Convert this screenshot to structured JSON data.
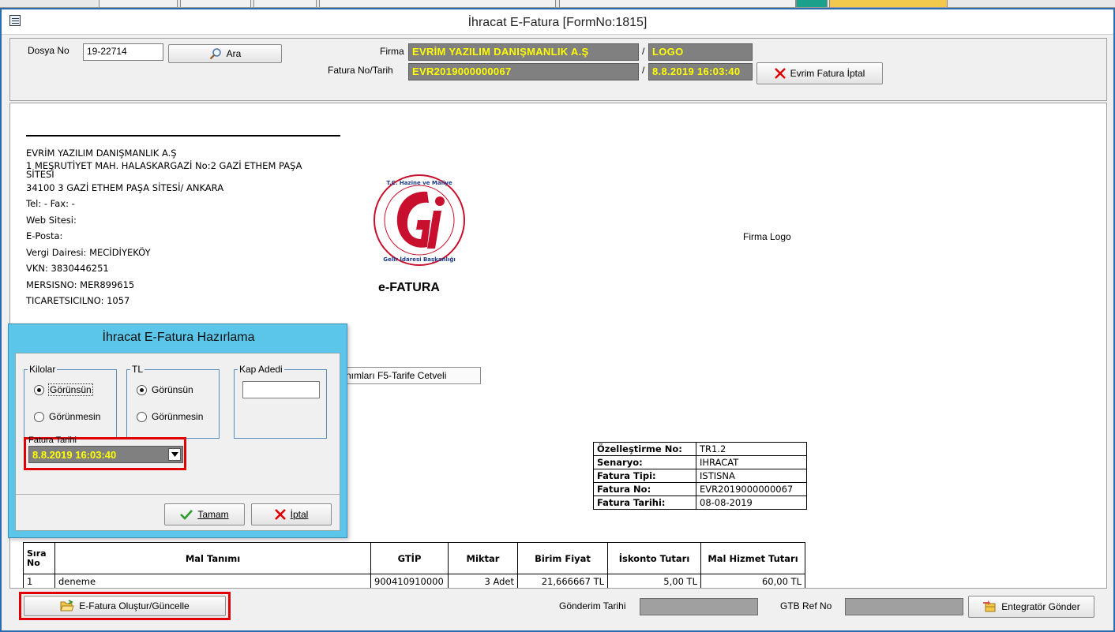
{
  "window": {
    "title": "İhracat E-Fatura [FormNo:1815]"
  },
  "search": {
    "dosya_no_label": "Dosya No",
    "dosya_no_value": "19-22714",
    "ara_button": "Ara",
    "firma_label": "Firma",
    "firma_value": "EVRİM YAZILIM DANIŞMANLIK A.Ş",
    "firma_code_sep": "/",
    "firma_code_value": "LOGO",
    "fatura_label": "Fatura No/Tarih",
    "fatura_no_value": "EVR2019000000067",
    "fatura_tarih_sep": "/",
    "fatura_tarih_value": "8.8.2019 16:03:40",
    "iptal_button": "Evrim Fatura İptal"
  },
  "invoice": {
    "company_lines": [
      "EVRİM YAZILIM DANIŞMANLIK A.Ş",
      "1 MEŞRUTİYET MAH. HALASKARGAZİ  No:2 GAZİ ETHEM PAŞA SİTESİ",
      "34100 3 GAZİ ETHEM PAŞA SİTESİ/ ANKARA",
      "Tel: - Fax: -",
      "Web Sitesi:",
      "E-Posta:",
      "Vergi Dairesi: MECİDİYEKÖY",
      "VKN: 3830446251",
      "MERSISNO: MER899615",
      "TICARETSICILNO: 1057"
    ],
    "gib_logo_text": "T.C. Hazine ve Maliye Bakanlığı · Gelir İdaresi Başkanlığı",
    "efatura_label": "e-FATURA",
    "firma_logo_label": "Firma Logo",
    "partial_button": "nımları F5-Tarife Cetveli",
    "info_rows": [
      {
        "key": "Özelleştirme No:",
        "value": "TR1.2"
      },
      {
        "key": "Senaryo:",
        "value": "IHRACAT"
      },
      {
        "key": "Fatura Tipi:",
        "value": "ISTISNA"
      },
      {
        "key": "Fatura No:",
        "value": "EVR2019000000067"
      },
      {
        "key": "Fatura Tarihi:",
        "value": "08-08-2019"
      }
    ],
    "items_headers": [
      "Sıra No",
      "Mal Tanımı",
      "GTİP",
      "Miktar",
      "Birim Fiyat",
      "İskonto Tutarı",
      "Mal Hizmet Tutarı"
    ],
    "items_rows": [
      [
        "1",
        "deneme",
        "900410910000",
        "3 Adet",
        "21,666667 TL",
        "5,00 TL",
        "60,00 TL"
      ]
    ]
  },
  "bottom": {
    "olustur_button": "E-Fatura Oluştur/Güncelle",
    "gonderim_label": "Gönderim Tarihi",
    "gtb_label": "GTB Ref No",
    "entegrator_button": "Entegratör Gönder"
  },
  "dialog": {
    "title": "İhracat E-Fatura Hazırlama",
    "kilolar_title": "Kilolar",
    "kilolar_options": [
      "Görünsün",
      "Görünmesin"
    ],
    "tl_title": "TL",
    "tl_options": [
      "Görünsün",
      "Görünmesin"
    ],
    "kap_title": "Kap Adedi",
    "kap_value": "",
    "fatura_tarihi_label": "Fatura Tarihi",
    "fatura_tarihi_value": "8.8.2019 16:03:40",
    "tamam_button": "Tamam",
    "iptal_button": "İptal"
  },
  "colors": {
    "dialog_bg": "#5bc6ea",
    "highlight_red": "#e00000",
    "yellow_text": "#ffff00",
    "dark_field": "#808080"
  }
}
